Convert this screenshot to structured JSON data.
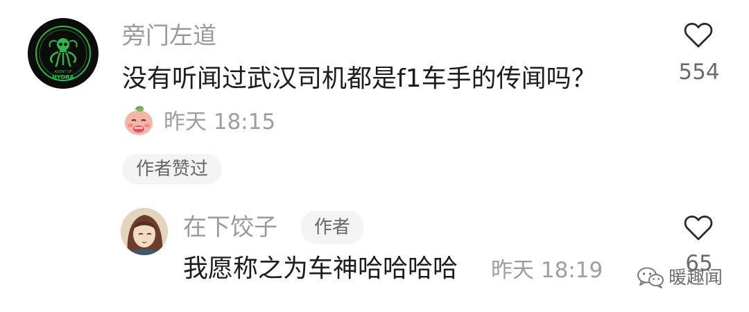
{
  "comments": [
    {
      "username": "旁门左道",
      "text": "没有听闻过武汉司机都是f1车手的传闻吗？",
      "time": "昨天 18:15",
      "likes": "554",
      "badge": "作者赞过",
      "avatar_logo_text": "HYDRA",
      "avatar_logo_subtext": "AGENT OF"
    }
  ],
  "reply": {
    "username": "在下饺子",
    "author_tag": "作者",
    "text": "我愿称之为车神哈哈哈哈",
    "time": "昨天 18:19",
    "likes": "65"
  },
  "watermark": {
    "label": "暖趣闻"
  },
  "icons": {
    "like": "heart-outline-icon",
    "sticker": "peach-sticker-icon",
    "watermark": "wechat-icon"
  },
  "colors": {
    "username": "#9a9a9a",
    "content": "#1c1c1c",
    "meta": "#9e9e9e",
    "pill_bg": "#f4f4f4",
    "hydra_green": "#2fb84a"
  }
}
